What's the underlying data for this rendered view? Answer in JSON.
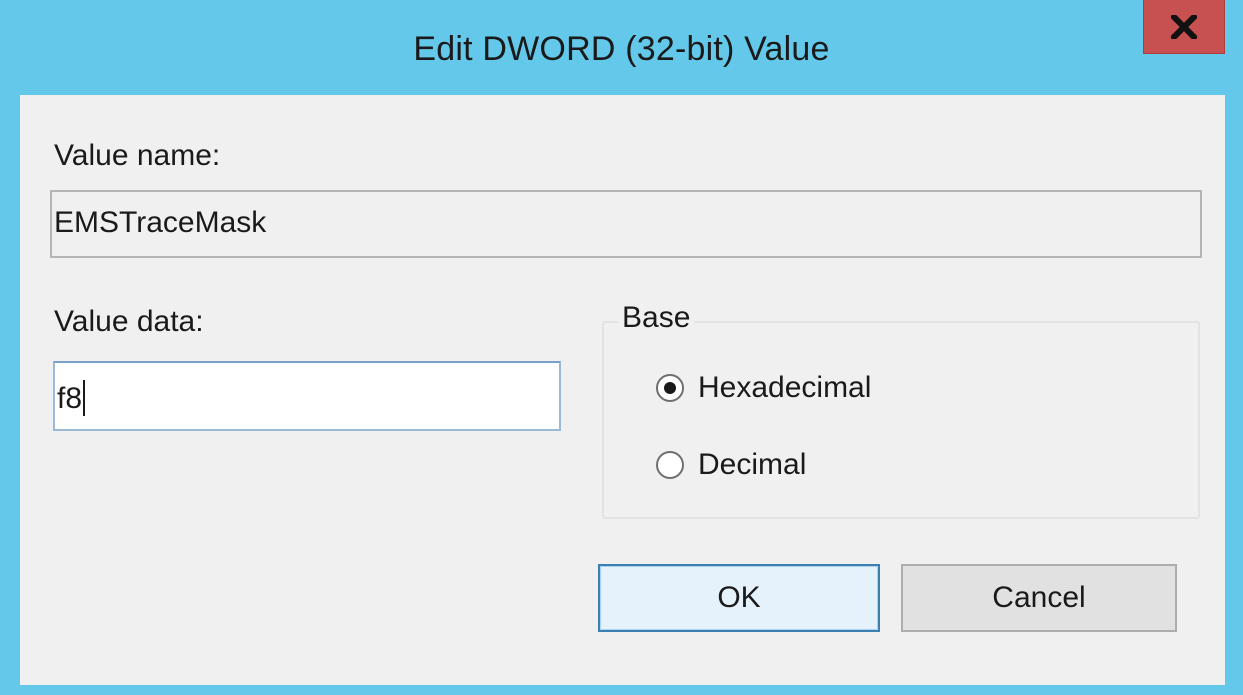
{
  "window": {
    "title": "Edit DWORD (32-bit) Value",
    "close_glyph": "x"
  },
  "value_name": {
    "label": "Value name:",
    "value": "EMSTraceMask"
  },
  "value_data": {
    "label": "Value data:",
    "value": "f8"
  },
  "base": {
    "legend": "Base",
    "options": [
      {
        "label": "Hexadecimal",
        "checked": true
      },
      {
        "label": "Decimal",
        "checked": false
      }
    ]
  },
  "buttons": {
    "ok_label": "OK",
    "cancel_label": "Cancel"
  },
  "colors": {
    "title_bar": "#63c8ea",
    "close_button": "#c75050",
    "dialog_body": "#f0f0f0",
    "default_button_border": "#3c7fb1"
  },
  "icons": {
    "close": "close-icon"
  }
}
